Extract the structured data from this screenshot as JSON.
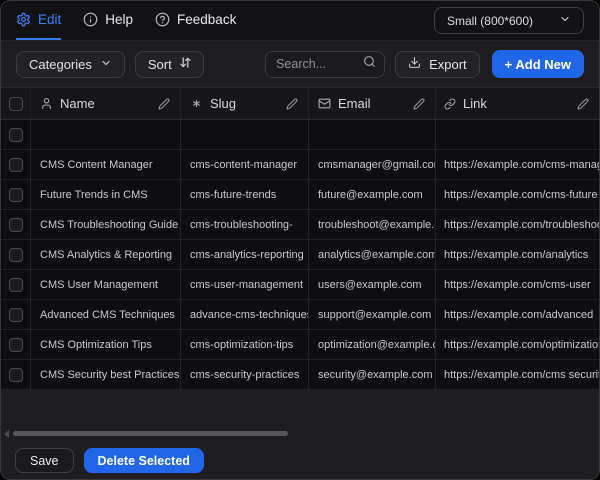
{
  "topbar": {
    "edit_tab": "Edit",
    "help_tab": "Help",
    "feedback_tab": "Feedback",
    "size_select_value": "Small (800*600)"
  },
  "toolbar": {
    "categories_label": "Categories",
    "sort_label": "Sort",
    "search_placeholder": "Search...",
    "export_label": "Export",
    "add_new_label": "+ Add New"
  },
  "table": {
    "columns": [
      {
        "label": "Name",
        "icon": "person-icon"
      },
      {
        "label": "Slug",
        "icon": "asterisk-icon"
      },
      {
        "label": "Email",
        "icon": "mail-icon"
      },
      {
        "label": "Link",
        "icon": "link-icon"
      }
    ],
    "rows": [
      {
        "name": "",
        "slug": "",
        "email": "",
        "link": ""
      },
      {
        "name": "CMS Content Manager",
        "slug": "cms-content-manager",
        "email": "cmsmanager@gmail.com",
        "link": "https://example.com/cms-manag"
      },
      {
        "name": "Future Trends in CMS",
        "slug": "cms-future-trends",
        "email": "future@example.com",
        "link": "https://example.com/cms-future"
      },
      {
        "name": "CMS Troubleshooting Guide",
        "slug": "cms-troubleshooting-",
        "email": "troubleshoot@example.com",
        "link": "https://example.com/troubleshoot"
      },
      {
        "name": "CMS Analytics & Reporting",
        "slug": "cms-analytics-reporting",
        "email": "analytics@example.com",
        "link": "https://example.com/analytics"
      },
      {
        "name": "CMS User Management",
        "slug": "cms-user-management",
        "email": "users@example.com",
        "link": "https://example.com/cms-user"
      },
      {
        "name": "Advanced CMS Techniques",
        "slug": "advance-cms-techniques",
        "email": "support@example.com",
        "link": "https://example.com/advanced"
      },
      {
        "name": "CMS Optimization Tips",
        "slug": "cms-optimization-tips",
        "email": "optimization@example.com",
        "link": "https://example.com/optimization"
      },
      {
        "name": "CMS Security best Practices",
        "slug": "cms-security-practices",
        "email": "security@example.com",
        "link": "https://example.com/cms security"
      }
    ]
  },
  "footer": {
    "save_label": "Save",
    "delete_selected_label": "Delete Selected"
  },
  "colors": {
    "accent_blue": "#2166e8",
    "edit_blue": "#3b82f6"
  }
}
